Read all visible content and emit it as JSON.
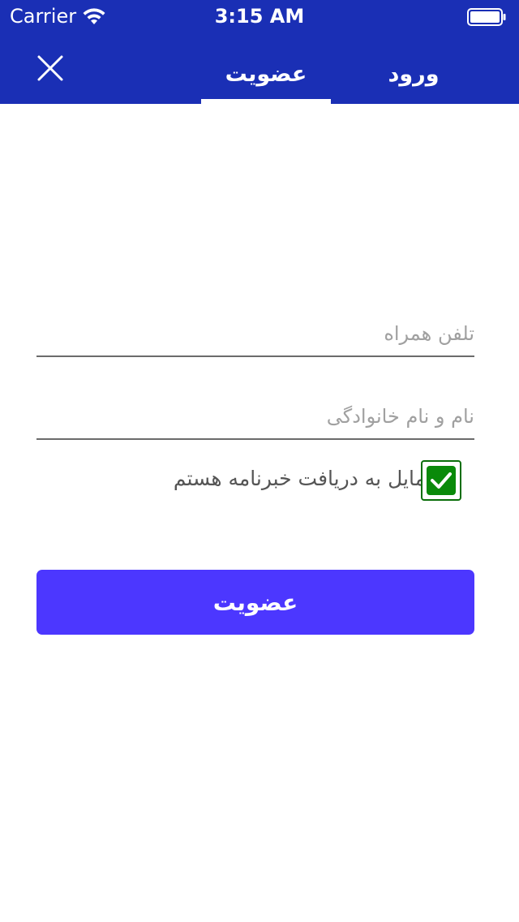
{
  "status_bar": {
    "carrier": "Carrier",
    "time": "3:15 AM",
    "icons": [
      "wifi-icon",
      "battery-icon"
    ]
  },
  "header": {
    "close_icon": "close-icon",
    "tabs": [
      {
        "label": "عضویت",
        "active": true
      },
      {
        "label": "ورود",
        "active": false
      }
    ],
    "background_color": "#1a2fb5"
  },
  "form": {
    "phone_placeholder": "تلفن همراه",
    "phone_value": "",
    "name_placeholder": "نام و نام خانوادگی",
    "name_value": "",
    "newsletter_label": "مایل به دریافت خبرنامه هستم",
    "newsletter_checked": true,
    "checkbox_color": "#0a8a0a",
    "submit_label": "عضویت",
    "submit_color": "#4c37ff"
  }
}
